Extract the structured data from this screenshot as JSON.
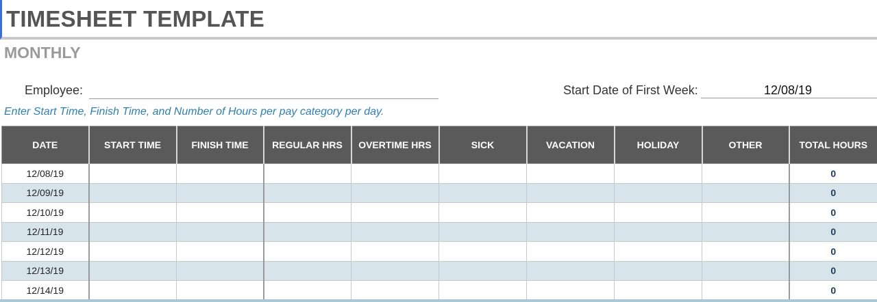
{
  "title": "TIMESHEET TEMPLATE",
  "subtitle": "MONTHLY",
  "employee": {
    "label": "Employee:",
    "value": ""
  },
  "start_date": {
    "label": "Start Date of First Week:",
    "value": "12/08/19"
  },
  "instruction": "Enter Start Time, Finish Time, and Number of Hours per pay category per day.",
  "table": {
    "headers": [
      "DATE",
      "START TIME",
      "FINISH TIME",
      "REGULAR HRS",
      "OVERTIME HRS",
      "SICK",
      "VACATION",
      "HOLIDAY",
      "OTHER",
      "TOTAL HOURS"
    ],
    "rows": [
      {
        "date": "12/08/19",
        "start": "",
        "finish": "",
        "regular": "",
        "overtime": "",
        "sick": "",
        "vacation": "",
        "holiday": "",
        "other": "",
        "total": "0"
      },
      {
        "date": "12/09/19",
        "start": "",
        "finish": "",
        "regular": "",
        "overtime": "",
        "sick": "",
        "vacation": "",
        "holiday": "",
        "other": "",
        "total": "0"
      },
      {
        "date": "12/10/19",
        "start": "",
        "finish": "",
        "regular": "",
        "overtime": "",
        "sick": "",
        "vacation": "",
        "holiday": "",
        "other": "",
        "total": "0"
      },
      {
        "date": "12/11/19",
        "start": "",
        "finish": "",
        "regular": "",
        "overtime": "",
        "sick": "",
        "vacation": "",
        "holiday": "",
        "other": "",
        "total": "0"
      },
      {
        "date": "12/12/19",
        "start": "",
        "finish": "",
        "regular": "",
        "overtime": "",
        "sick": "",
        "vacation": "",
        "holiday": "",
        "other": "",
        "total": "0"
      },
      {
        "date": "12/13/19",
        "start": "",
        "finish": "",
        "regular": "",
        "overtime": "",
        "sick": "",
        "vacation": "",
        "holiday": "",
        "other": "",
        "total": "0"
      },
      {
        "date": "12/14/19",
        "start": "",
        "finish": "",
        "regular": "",
        "overtime": "",
        "sick": "",
        "vacation": "",
        "holiday": "",
        "other": "",
        "total": "0"
      }
    ]
  },
  "colors": {
    "header_bg": "#5a5a5a",
    "band_bg": "#d7e4ec",
    "instruction_text": "#2f7fb0",
    "total_text": "#1f3b5a"
  }
}
